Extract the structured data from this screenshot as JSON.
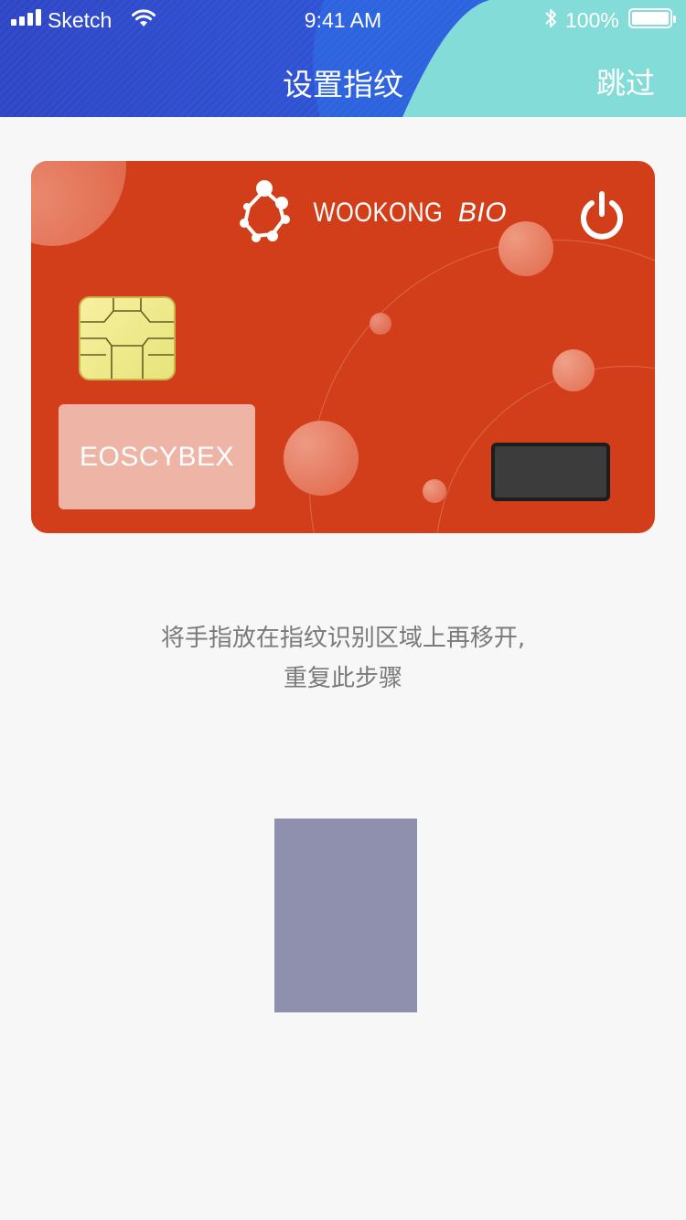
{
  "status_bar": {
    "carrier": "Sketch",
    "time": "9:41 AM",
    "battery": "100%"
  },
  "header": {
    "title": "设置指纹",
    "skip_label": "跳过"
  },
  "card": {
    "brand": "WOOKONG",
    "brand_suffix": "BIO",
    "name": "EOSCYBEX"
  },
  "instruction": {
    "line1": "将手指放在指纹识别区域上再移开,",
    "line2": "重复此步骤"
  },
  "colors": {
    "header_blue": "#2f4fd0",
    "header_teal": "#84dcd9",
    "card_red": "#d23e19",
    "fingerprint_area": "#8e90ae"
  },
  "icons": [
    "signal-icon",
    "wifi-icon",
    "bluetooth-icon",
    "battery-icon",
    "power-icon",
    "logo-icon",
    "chip-icon",
    "fingerprint-sensor-icon"
  ]
}
